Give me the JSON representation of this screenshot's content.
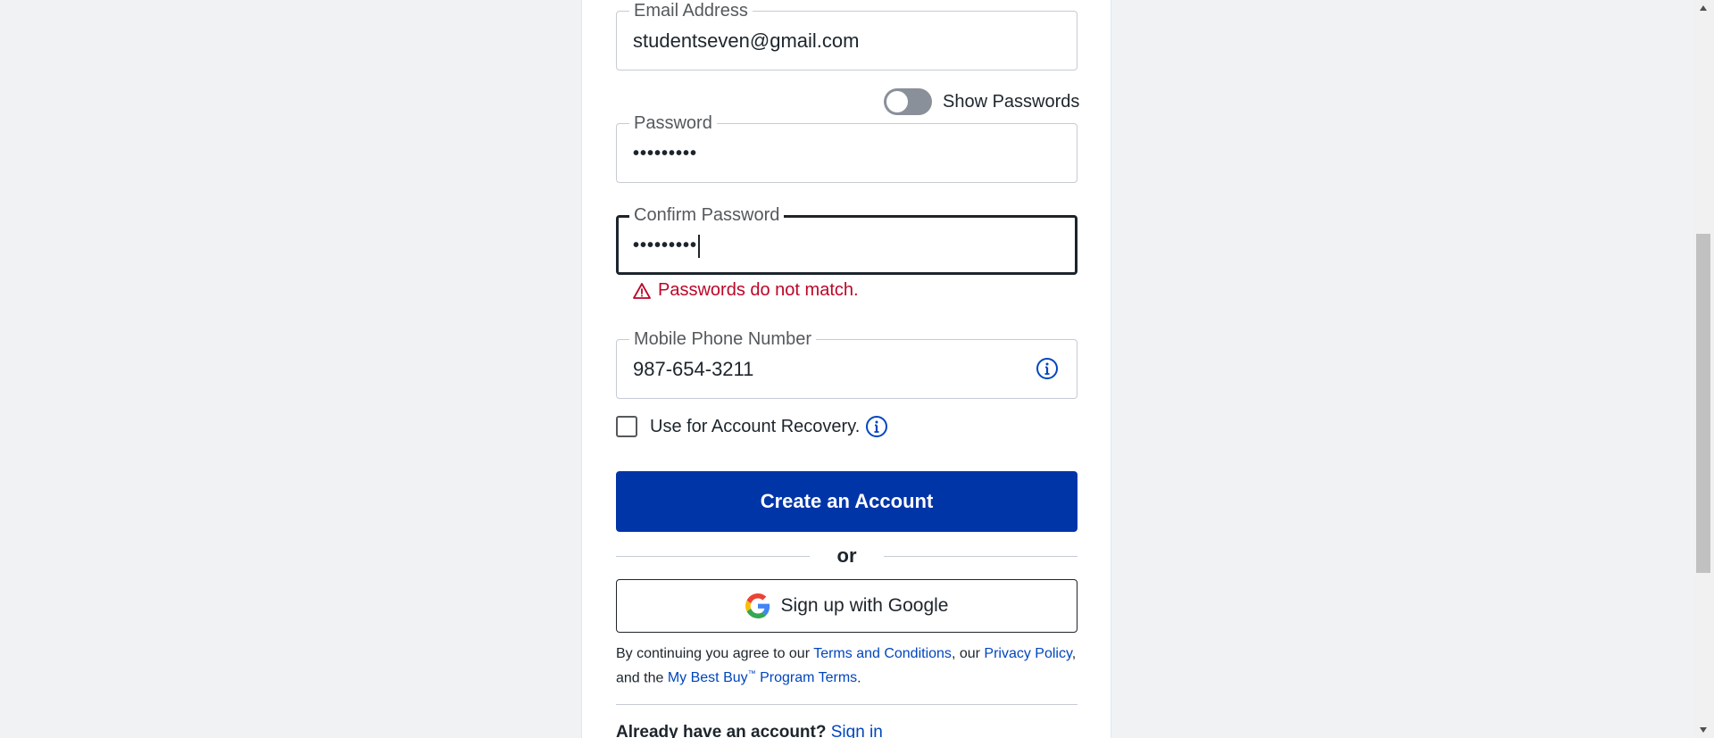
{
  "form": {
    "email": {
      "label": "Email Address",
      "value": "studentseven@gmail.com"
    },
    "show_passwords": {
      "label": "Show Passwords",
      "on": false
    },
    "password": {
      "label": "Password",
      "masked_value": "•••••••••"
    },
    "confirm_password": {
      "label": "Confirm Password",
      "masked_value": "•••••••••",
      "focused": true
    },
    "error": {
      "message": "Passwords do not match."
    },
    "phone": {
      "label": "Mobile Phone Number",
      "value": "987-654-3211"
    },
    "recovery": {
      "label": "Use for Account Recovery.",
      "checked": false
    },
    "create_button": "Create an Account",
    "divider_text": "or",
    "google_button": "Sign up with Google",
    "legal": {
      "prefix": "By continuing you agree to our ",
      "terms_link": "Terms and Conditions",
      "mid1": ", our ",
      "privacy_link": "Privacy Policy",
      "mid2": ", and the ",
      "program_link_a": "My Best Buy",
      "program_tm": "™",
      "program_link_b": " Program Terms",
      "suffix": "."
    },
    "signin": {
      "question": "Already have an account?",
      "link": "Sign in"
    }
  },
  "colors": {
    "primary": "#0035a8",
    "link": "#0046be",
    "error": "#bb0628",
    "toggle_off": "#8a9099"
  },
  "icons": {
    "info": "info-circle-icon",
    "warning": "warning-triangle-icon",
    "google": "google-g-icon"
  }
}
